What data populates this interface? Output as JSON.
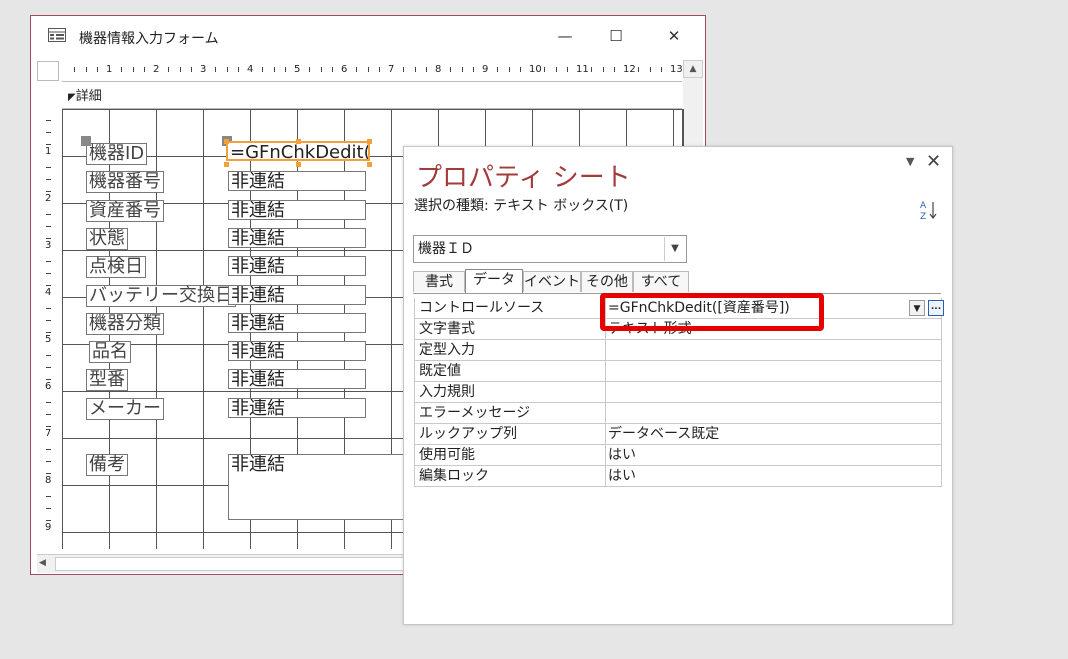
{
  "form_window": {
    "title": "機器情報入力フォーム",
    "icon": "form-icon",
    "buttons": {
      "minimize": "—",
      "maximize": "☐",
      "close": "✕"
    },
    "section_label": "詳細",
    "ruler_numbers": [
      "1",
      "2",
      "3",
      "4",
      "5",
      "6",
      "7",
      "8",
      "9",
      "10",
      "11",
      "12",
      "13"
    ],
    "vruler_numbers": [
      "1",
      "2",
      "3",
      "4",
      "5",
      "6",
      "7",
      "8",
      "9"
    ],
    "labels": [
      "機器ID",
      "機器番号",
      "資産番号",
      "状態",
      "点検日",
      "バッテリー交換日",
      "機器分類",
      "品名",
      "型番",
      "メーカー",
      "備考"
    ],
    "textboxes": {
      "selected": "=GFnChkDedit([資",
      "unbound": "非連結"
    }
  },
  "property_sheet": {
    "title": "プロパティ シート",
    "selection_type": "選択の種類: テキスト ボックス(T)",
    "combo_value": "機器ＩＤ",
    "tabs": [
      "書式",
      "データ",
      "イベント",
      "その他",
      "すべて"
    ],
    "active_tab": "データ",
    "rows": [
      {
        "name": "コントロールソース",
        "value": "=GFnChkDedit([資産番号])"
      },
      {
        "name": "文字書式",
        "value": "テキスト形式"
      },
      {
        "name": "定型入力",
        "value": ""
      },
      {
        "name": "既定値",
        "value": ""
      },
      {
        "name": "入力規則",
        "value": ""
      },
      {
        "name": "エラーメッセージ",
        "value": ""
      },
      {
        "name": "ルックアップ列",
        "value": "データベース既定"
      },
      {
        "name": "使用可能",
        "value": "はい"
      },
      {
        "name": "編集ロック",
        "value": "はい"
      }
    ],
    "more_button": "...",
    "highlight_color": "#e60000",
    "title_color": "#a33b3b"
  }
}
